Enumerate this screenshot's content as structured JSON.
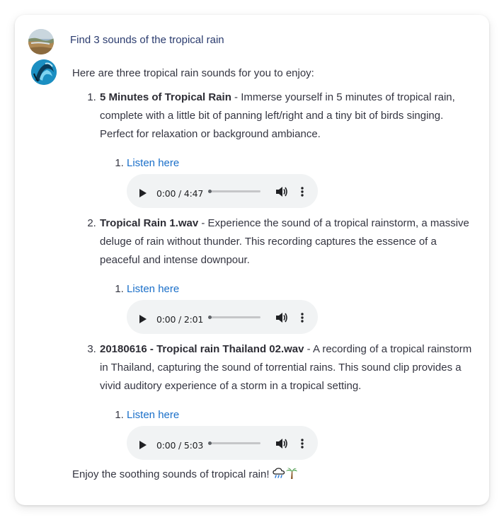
{
  "user_message": "Find 3 sounds of the tropical rain",
  "assistant": {
    "intro": "Here are three tropical rain sounds for you to enjoy:",
    "items": [
      {
        "title": "5 Minutes of Tropical Rain",
        "description": " - Immerse yourself in 5 minutes of tropical rain, complete with a little bit of panning left/right and a tiny bit of birds singing. Perfect for relaxation or background ambiance.",
        "link_label": "Listen here",
        "audio_time": "0:00 / 4:47"
      },
      {
        "title": "Tropical Rain 1.wav",
        "description": " - Experience the sound of a tropical rainstorm, a massive deluge of rain without thunder. This recording captures the essence of a peaceful and intense downpour.",
        "link_label": "Listen here",
        "audio_time": "0:00 / 2:01"
      },
      {
        "title": "20180616 - Tropical rain Thailand 02.wav",
        "description": " - A recording of a tropical rainstorm in Thailand, capturing the sound of torrential rains. This sound clip provides a vivid auditory experience of a storm in a tropical setting.",
        "link_label": "Listen here",
        "audio_time": "0:00 / 5:03"
      }
    ],
    "outro": "Enjoy the soothing sounds of tropical rain!",
    "outro_emoji": [
      "cloud-rain-icon",
      "palm-tree-icon"
    ]
  },
  "colors": {
    "link": "#1a6fc9",
    "user_text": "#2a3b6e",
    "player_bg": "#f1f3f4"
  }
}
